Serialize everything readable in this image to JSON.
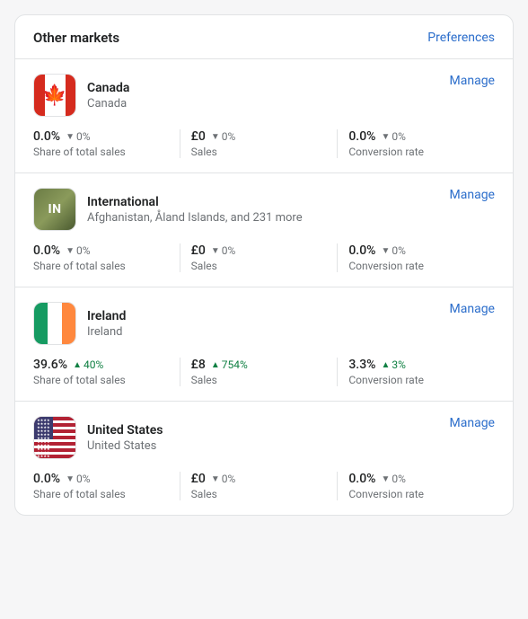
{
  "header": {
    "title": "Other markets",
    "preferences_label": "Preferences"
  },
  "markets": [
    {
      "id": "canada",
      "flag_type": "canada",
      "name": "Canada",
      "subtitle": "Canada",
      "manage_label": "Manage",
      "stats": [
        {
          "main": "0.0%",
          "change_direction": "down",
          "change_value": "0%",
          "change_type": "negative",
          "label": "Share of total sales"
        },
        {
          "main": "£0",
          "change_direction": "down",
          "change_value": "0%",
          "change_type": "negative",
          "label": "Sales"
        },
        {
          "main": "0.0%",
          "change_direction": "down",
          "change_value": "0%",
          "change_type": "negative",
          "label": "Conversion rate"
        }
      ]
    },
    {
      "id": "international",
      "flag_type": "international",
      "flag_label": "IN",
      "name": "International",
      "subtitle": "Afghanistan, Åland Islands, and 231 more",
      "manage_label": "Manage",
      "stats": [
        {
          "main": "0.0%",
          "change_direction": "down",
          "change_value": "0%",
          "change_type": "negative",
          "label": "Share of total sales"
        },
        {
          "main": "£0",
          "change_direction": "down",
          "change_value": "0%",
          "change_type": "negative",
          "label": "Sales"
        },
        {
          "main": "0.0%",
          "change_direction": "down",
          "change_value": "0%",
          "change_type": "negative",
          "label": "Conversion rate"
        }
      ]
    },
    {
      "id": "ireland",
      "flag_type": "ireland",
      "name": "Ireland",
      "subtitle": "Ireland",
      "manage_label": "Manage",
      "stats": [
        {
          "main": "39.6%",
          "change_direction": "up",
          "change_value": "40%",
          "change_type": "positive",
          "label": "Share of total sales"
        },
        {
          "main": "£8",
          "change_direction": "up",
          "change_value": "754%",
          "change_type": "positive",
          "label": "Sales"
        },
        {
          "main": "3.3%",
          "change_direction": "up",
          "change_value": "3%",
          "change_type": "positive",
          "label": "Conversion rate"
        }
      ]
    },
    {
      "id": "united-states",
      "flag_type": "us",
      "name": "United States",
      "subtitle": "United States",
      "manage_label": "Manage",
      "stats": [
        {
          "main": "0.0%",
          "change_direction": "down",
          "change_value": "0%",
          "change_type": "negative",
          "label": "Share of total sales"
        },
        {
          "main": "£0",
          "change_direction": "down",
          "change_value": "0%",
          "change_type": "negative",
          "label": "Sales"
        },
        {
          "main": "0.0%",
          "change_direction": "down",
          "change_value": "0%",
          "change_type": "negative",
          "label": "Conversion rate"
        }
      ]
    }
  ]
}
